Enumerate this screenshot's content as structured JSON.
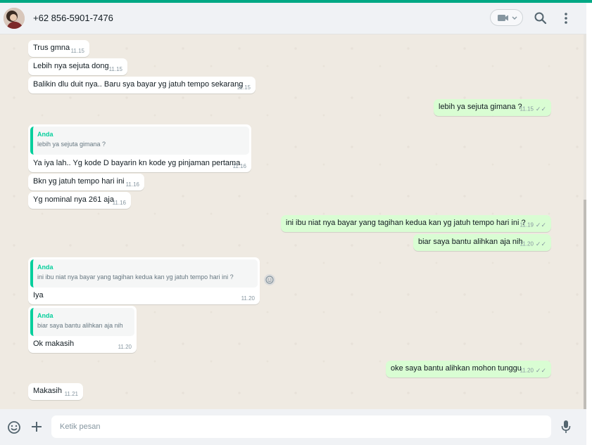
{
  "header": {
    "contact_name": "+62 856-5901-7476"
  },
  "composer": {
    "placeholder": "Ketik pesan"
  },
  "messages": [
    {
      "text": "Trus gmna",
      "time": "11.15"
    },
    {
      "text": "Lebih nya sejuta dong",
      "time": "11.15"
    },
    {
      "text": "Balikin dlu duit nya.. Baru sya bayar yg jatuh tempo sekarang",
      "time": "11.15"
    },
    {
      "text": "lebih ya sejuta gimana ?",
      "time": "11.15"
    },
    {
      "quote_author": "Anda",
      "quote_text": "lebih ya sejuta gimana ?",
      "text": "Ya iya lah.. Yg kode D bayarin kn kode yg pinjaman pertama",
      "time": "11.16"
    },
    {
      "text": "Bkn yg jatuh tempo hari ini",
      "time": "11.16"
    },
    {
      "text": "Yg nominal nya 261 aja",
      "time": "11.16"
    },
    {
      "text": "ini ibu niat nya bayar yang tagihan kedua kan yg jatuh tempo hari ini ?",
      "time": "11.19"
    },
    {
      "text": "biar saya bantu alihkan aja nih",
      "time": "11.20"
    },
    {
      "quote_author": "Anda",
      "quote_text": "ini ibu niat nya bayar yang tagihan kedua kan yg jatuh tempo hari ini ?",
      "text": "Iya",
      "time": "11.20"
    },
    {
      "quote_author": "Anda",
      "quote_text": "biar saya bantu alihkan aja nih",
      "text": "Ok makasih",
      "time": "11.20"
    },
    {
      "text": "oke saya bantu alihkan mohon tunggu",
      "time": "11.20"
    },
    {
      "text": "Makasih",
      "time": "11.21"
    }
  ]
}
